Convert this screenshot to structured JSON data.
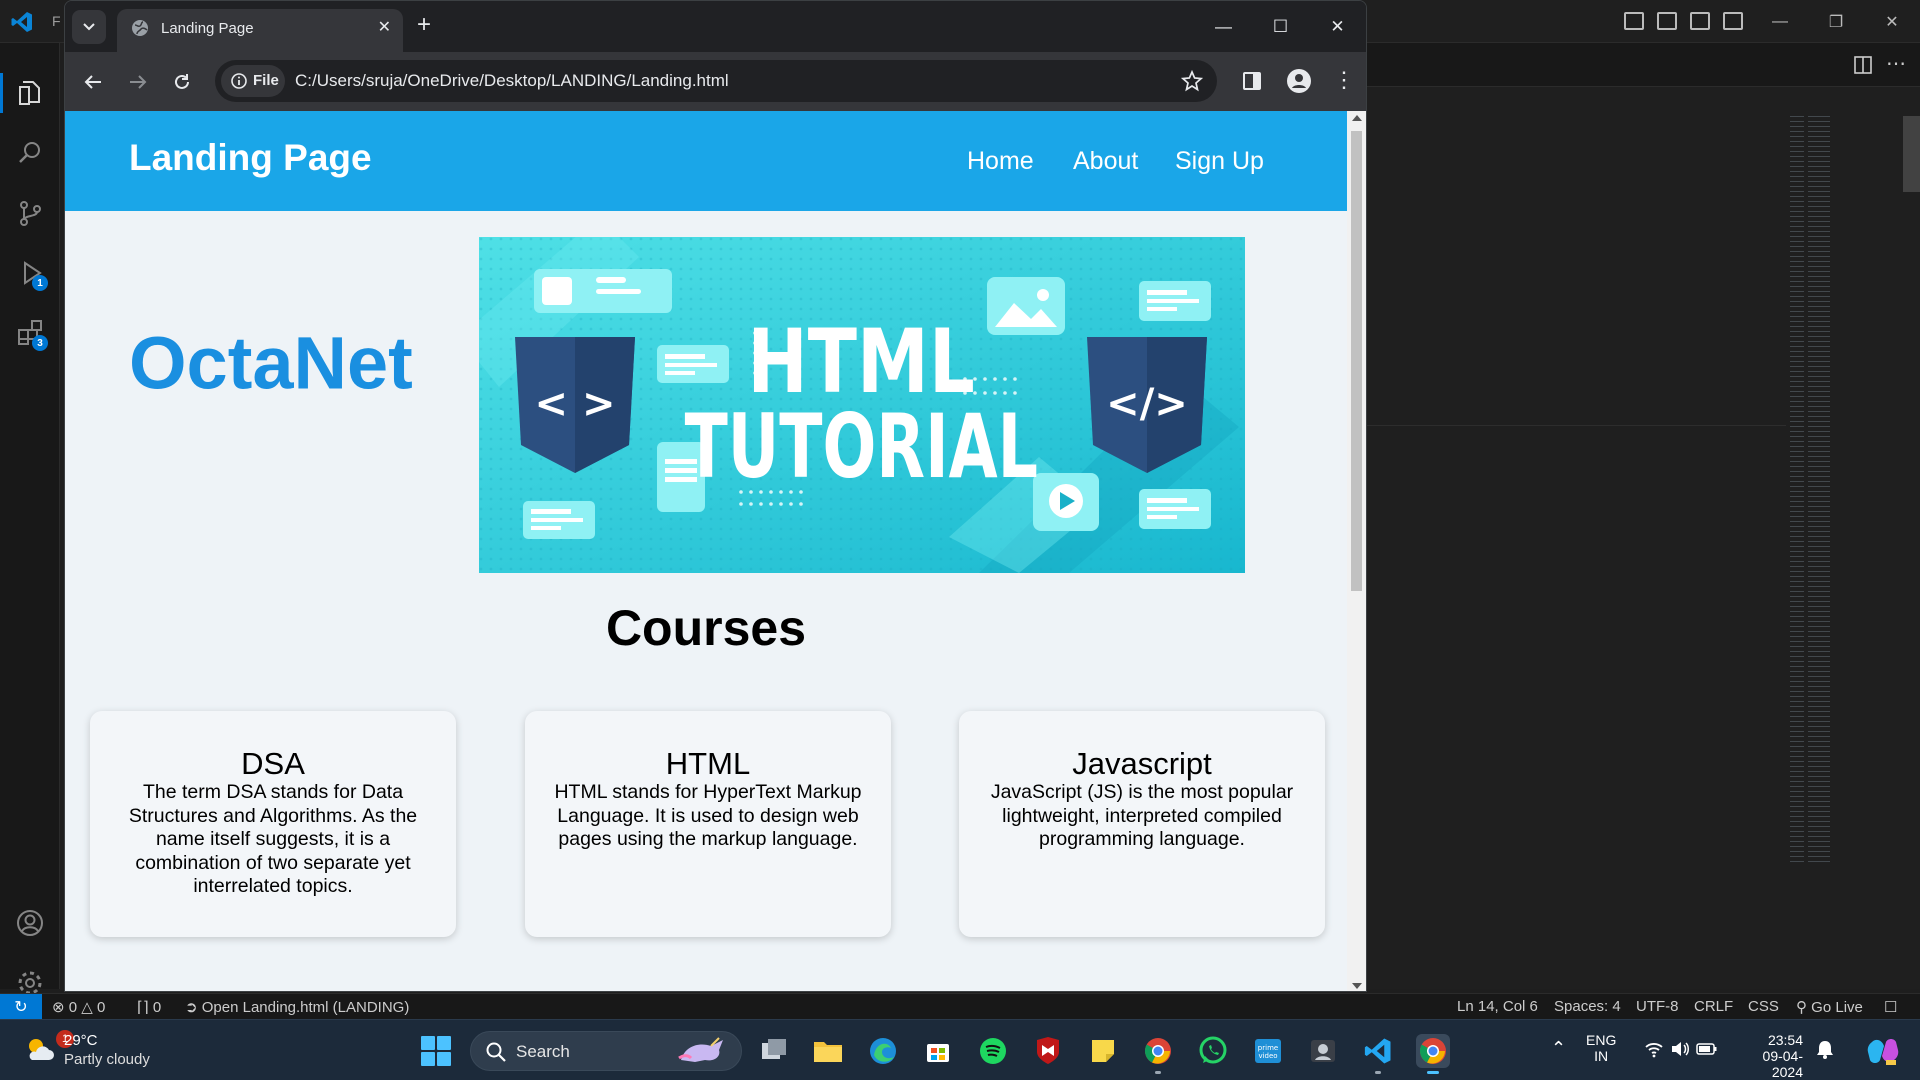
{
  "vscode": {
    "menu_initial": "F",
    "status": {
      "errors": "0",
      "warnings": "0",
      "ports": "0",
      "open_file": "Open Landing.html (LANDING)",
      "cursor": "Ln 14, Col 6",
      "spaces": "Spaces: 4",
      "encoding": "UTF-8",
      "eol": "CRLF",
      "language": "CSS",
      "go_live": "Go Live"
    },
    "activity_badges": {
      "run_debug": "1",
      "extensions": "3"
    }
  },
  "chrome": {
    "tab_title": "Landing Page",
    "chip_label": "File",
    "url": "C:/Users/sruja/OneDrive/Desktop/LANDING/Landing.html"
  },
  "page": {
    "brand": "Landing Page",
    "nav": [
      "Home",
      "About",
      "Sign Up"
    ],
    "hero_title": "OctaNet",
    "hero_image_text": [
      "HTML",
      "TUTORIAL"
    ],
    "courses_title": "Courses",
    "courses": [
      {
        "title": "DSA",
        "description": "The term DSA stands for Data Structures and Algorithms. As the name itself suggests, it is a combination of two separate yet interrelated topics."
      },
      {
        "title": "HTML",
        "description": "HTML stands for HyperText Markup Language. It is used to design web pages using the markup language."
      },
      {
        "title": "Javascript",
        "description": "JavaScript (JS) is the most popular lightweight, interpreted compiled programming language."
      }
    ]
  },
  "taskbar": {
    "weather_temp": "29°C",
    "weather_desc": "Partly cloudy",
    "weather_badge": "1",
    "search_label": "Search",
    "lang_top": "ENG",
    "lang_bottom": "IN",
    "time": "23:54",
    "date": "09-04-2024"
  },
  "colors": {
    "header_blue": "#1aa6e8",
    "brand_text": "#1a8fe0",
    "page_bg": "#eef3f7",
    "vscode_accent": "#0078d4"
  }
}
